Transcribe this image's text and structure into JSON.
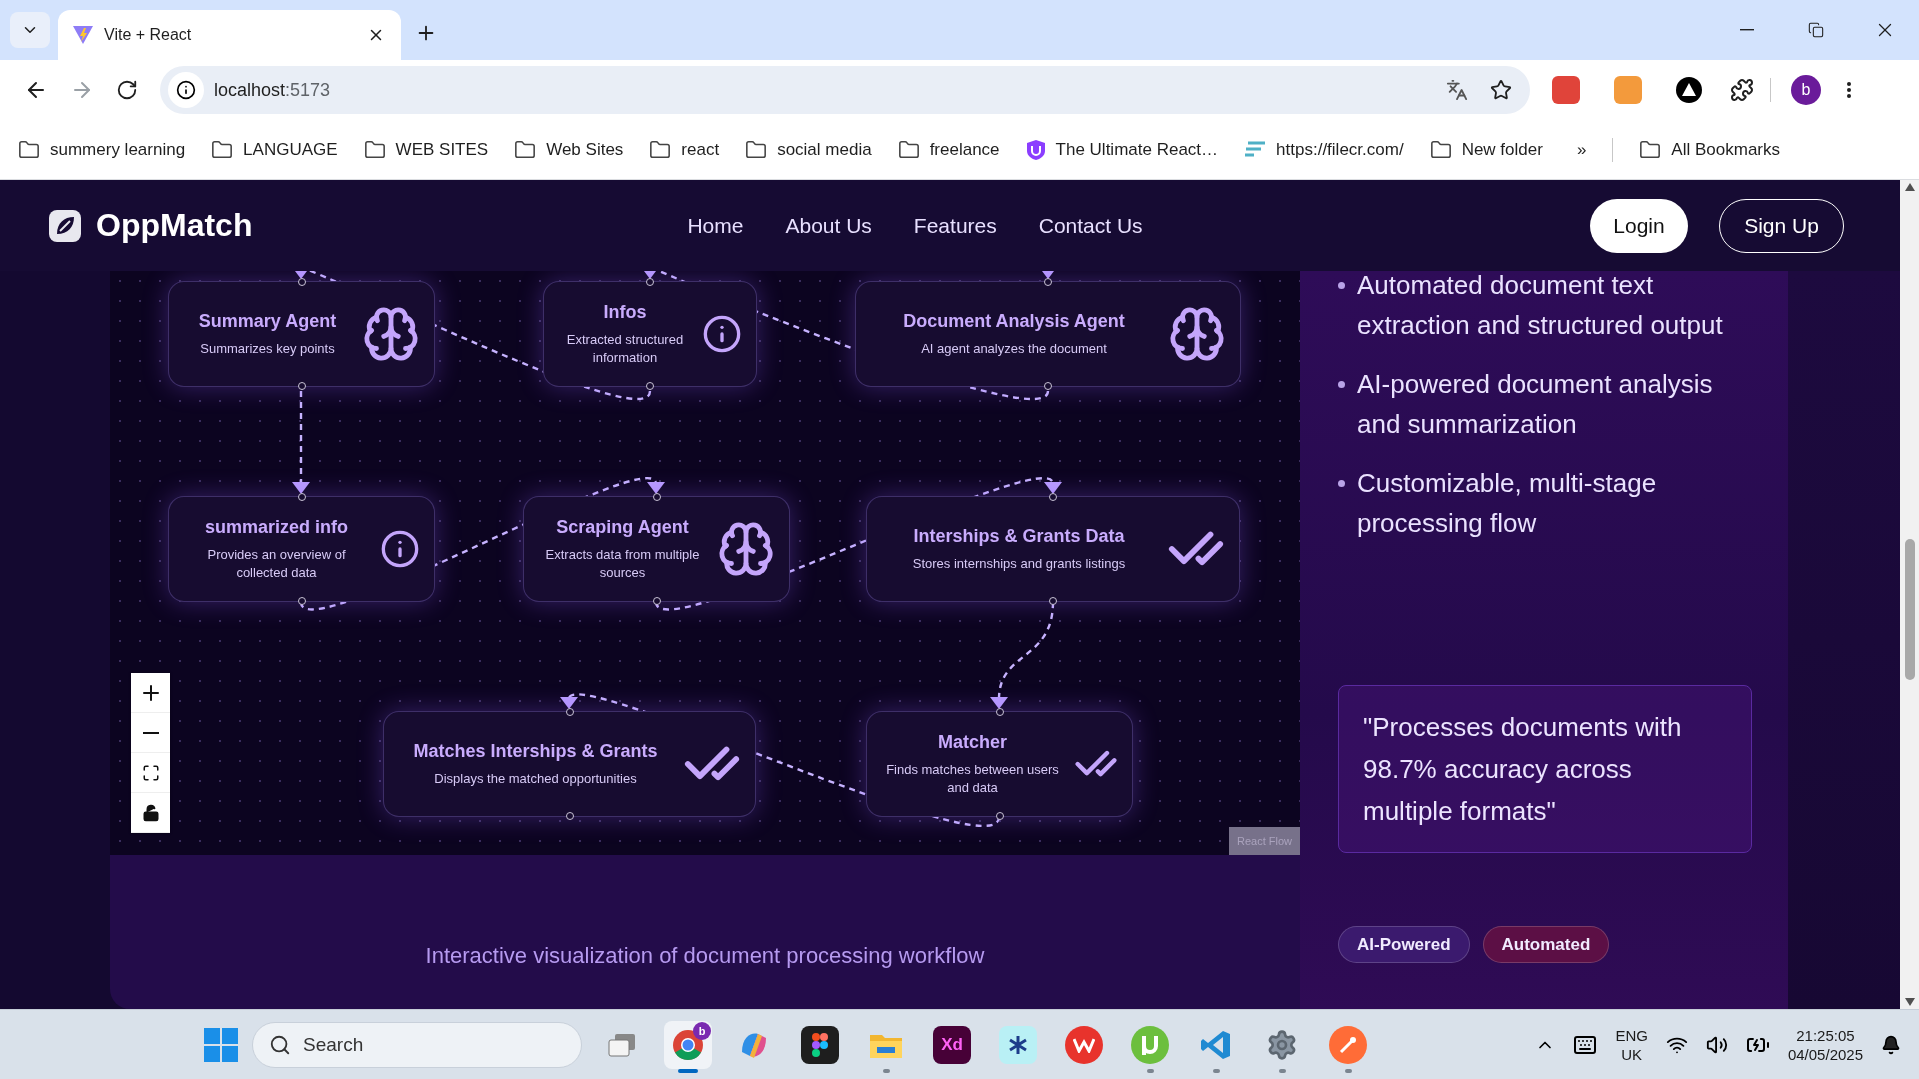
{
  "browser": {
    "tab": {
      "title": "Vite + React"
    },
    "address": {
      "host": "localhost",
      "port": ":5173"
    },
    "profile": "b",
    "bookmarks": [
      {
        "kind": "folder",
        "label": "summery learning"
      },
      {
        "kind": "folder",
        "label": "LANGUAGE"
      },
      {
        "kind": "folder",
        "label": "WEB SITES"
      },
      {
        "kind": "folder",
        "label": "Web Sites"
      },
      {
        "kind": "folder",
        "label": "react"
      },
      {
        "kind": "folder",
        "label": "social media"
      },
      {
        "kind": "folder",
        "label": "freelance"
      },
      {
        "kind": "course",
        "label": "The Ultimate React…"
      },
      {
        "kind": "download",
        "label": "https://filecr.com/"
      },
      {
        "kind": "folder",
        "label": "New folder"
      }
    ],
    "more": "»",
    "all_bookmarks": "All Bookmarks"
  },
  "navbar": {
    "brand": "OppMatch",
    "links": [
      "Home",
      "About Us",
      "Features",
      "Contact Us"
    ],
    "login": "Login",
    "signup": "Sign Up"
  },
  "flow": {
    "nodes": [
      {
        "kind": "agent",
        "title": "Summary Agent",
        "description": "Summarizes key points"
      },
      {
        "kind": "info",
        "title": "Infos",
        "description": "Extracted structured information"
      },
      {
        "kind": "agent",
        "title": "Document Analysis Agent",
        "description": "AI agent analyzes the document"
      },
      {
        "kind": "info",
        "title": "summarized info",
        "description": "Provides an overview of collected data"
      },
      {
        "kind": "agent",
        "title": "Scraping Agent",
        "description": "Extracts data from multiple sources"
      },
      {
        "kind": "data",
        "title": "Interships & Grants Data",
        "description": "Stores internships and grants listings"
      },
      {
        "kind": "data",
        "title": "Matches Interships & Grants",
        "description": "Displays the matched opportunities"
      },
      {
        "kind": "data",
        "title": "Matcher",
        "description": "Finds matches between users and data"
      }
    ],
    "attribution": "React Flow"
  },
  "caption": "Interactive visualization of document processing workflow",
  "features": [
    "Automated document text extraction and structured output",
    "AI-powered document analysis and summarization",
    "Customizable, multi-stage processing flow"
  ],
  "quote": "\"Processes documents with 98.7% accuracy across multiple formats\"",
  "tags": [
    {
      "label": "AI-Powered",
      "color": "#3b1a6e"
    },
    {
      "label": "Automated",
      "color": "#5c0f45"
    }
  ],
  "taskbar": {
    "search": "Search",
    "apps": [
      {
        "kind": "taskview",
        "running": false,
        "selected": false
      },
      {
        "kind": "chrome",
        "running": true,
        "selected": true,
        "badge": "b"
      },
      {
        "kind": "copilot",
        "running": false,
        "selected": false
      },
      {
        "kind": "figma",
        "running": false,
        "selected": false
      },
      {
        "kind": "explorer",
        "running": true,
        "selected": false
      },
      {
        "kind": "xd",
        "running": false,
        "selected": false,
        "label": "Xd"
      },
      {
        "kind": "asterisk",
        "running": false,
        "selected": false
      },
      {
        "kind": "wps",
        "running": false,
        "selected": false
      },
      {
        "kind": "torrent",
        "running": true,
        "selected": false
      },
      {
        "kind": "vscode",
        "running": true,
        "selected": false
      },
      {
        "kind": "settings",
        "running": true,
        "selected": false
      },
      {
        "kind": "postman",
        "running": true,
        "selected": false
      }
    ],
    "language": "ENG",
    "region": "UK",
    "time": "21:25:05",
    "date": "04/05/2025"
  }
}
